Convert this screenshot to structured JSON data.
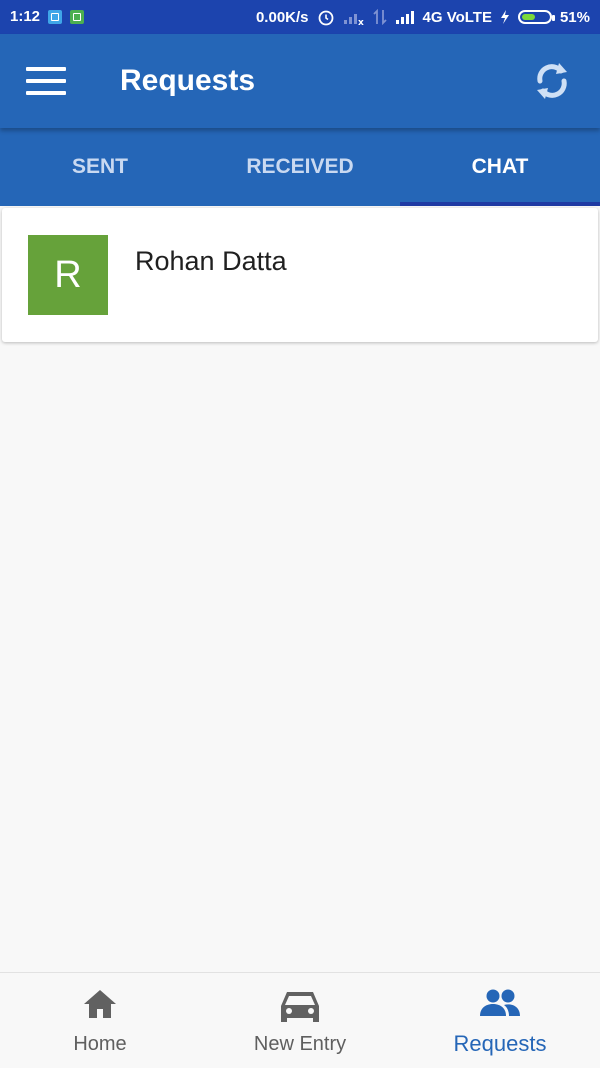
{
  "status_bar": {
    "time": "1:12",
    "network_speed": "0.00K/s",
    "network": "4G VoLTE",
    "battery": "51%",
    "battery_level": 0.51
  },
  "app_bar": {
    "title": "Requests",
    "menu_icon": "menu-icon",
    "refresh_icon": "refresh-icon"
  },
  "tabs": [
    {
      "label": "SENT",
      "active": false
    },
    {
      "label": "RECEIVED",
      "active": false
    },
    {
      "label": "CHAT",
      "active": true
    }
  ],
  "chats": [
    {
      "initial": "R",
      "name": "Rohan Datta",
      "avatar_color": "#66a23a"
    }
  ],
  "bottom_nav": [
    {
      "label": "Home",
      "icon": "home-icon",
      "active": false
    },
    {
      "label": "New Entry",
      "icon": "car-icon",
      "active": false
    },
    {
      "label": "Requests",
      "icon": "people-icon",
      "active": true
    }
  ],
  "colors": {
    "primary": "#2566b7",
    "status_bar": "#1c44ae",
    "tab_indicator": "#1f3aa3",
    "inactive_tab": "#c9d9f1",
    "nav_inactive": "#5f5f5f"
  }
}
